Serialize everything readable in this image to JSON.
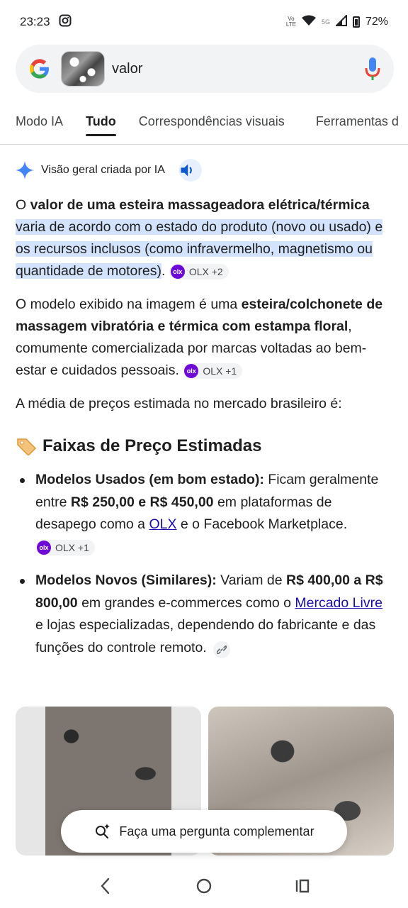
{
  "status_bar": {
    "time": "23:23",
    "network_label_top": "Vo",
    "network_label_bottom": "LTE",
    "network_5g": "5G",
    "battery": "72%"
  },
  "search": {
    "query": "valor"
  },
  "tabs": [
    {
      "label": "Modo IA",
      "active": false
    },
    {
      "label": "Tudo",
      "active": true
    },
    {
      "label": "Correspondências visuais",
      "active": false
    },
    {
      "label": "Ferramentas d",
      "active": false
    }
  ],
  "ai_overview": {
    "header": "Visão geral criada por IA",
    "p1": {
      "t1": "O ",
      "b1": "valor de uma esteira massageadora elétrica/térmica",
      "t2": " ",
      "hl": "varia de acordo com o estado do produto (novo ou usado) e os recursos inclusos (como infravermelho, magnetismo ou quantidade de motores)",
      "t3": ".",
      "chip": "OLX +2"
    },
    "p2": {
      "t1": "O modelo exibido na imagem é uma ",
      "b1": "esteira/colchonete de massagem vibratória e térmica com estampa floral",
      "t2": ", comumente comercializada por marcas voltadas ao bem-estar e cuidados pessoais.",
      "chip": "OLX +1"
    },
    "p3": "A média de preços estimada no mercado brasileiro é:",
    "section_title": "Faixas de Preço Estimadas",
    "items": [
      {
        "b1": "Modelos Usados (em bom estado):",
        "t1": " Ficam geralmente entre ",
        "b2": "R$ 250,00 e R$ 450,00",
        "t2": " em plataformas de desapego como a ",
        "link": "OLX",
        "t3": " e o Facebook Marketplace.",
        "chip": "OLX +1"
      },
      {
        "b1": "Modelos Novos (Similares):",
        "t1": " Variam de ",
        "b2": "R$ 400,00 a R$ 800,00",
        "t2": " em grandes e-commerces como o ",
        "link": "Mercado Livre",
        "t3": " e lojas especializadas, dependendo do fabricante e das funções do controle remoto."
      }
    ]
  },
  "followup": {
    "label": "Faça uma pergunta complementar"
  },
  "colors": {
    "highlight": "#d3e3fd",
    "link": "#1a0dab",
    "olx_brand": "#6e0ad6",
    "google_blue": "#4285f4"
  }
}
